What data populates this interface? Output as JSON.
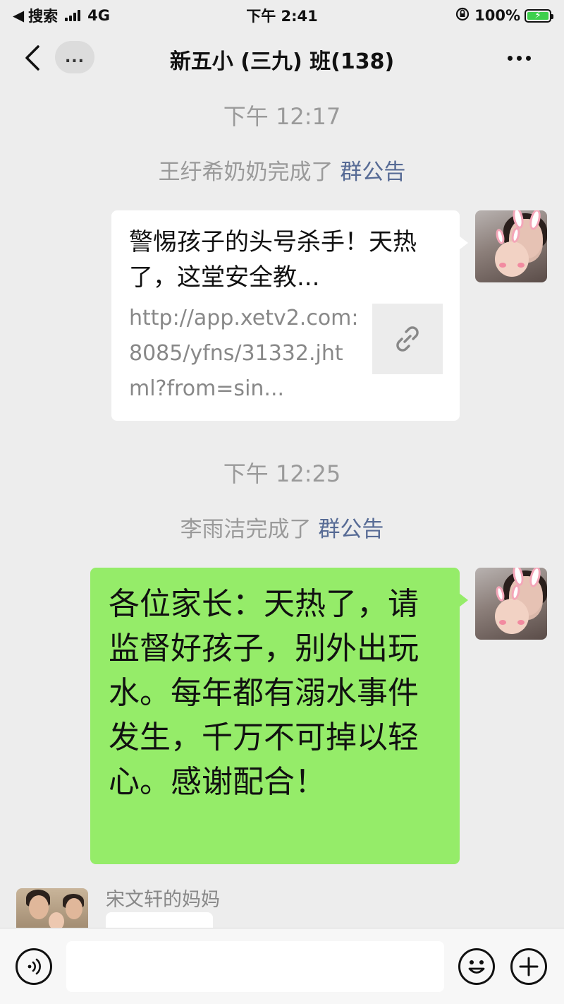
{
  "status_bar": {
    "back_app": "搜索",
    "network": "4G",
    "time": "下午 2:41",
    "battery": "100%"
  },
  "nav": {
    "back_label": "<",
    "unread_label": "...",
    "title": "新五小 (三九) 班(138)",
    "more_icon": "more-dots-icon"
  },
  "messages": [
    {
      "type": "time",
      "text": "下午 12:17"
    },
    {
      "type": "system",
      "text": "王纡希奶奶完成了",
      "link": "群公告"
    },
    {
      "type": "link_card",
      "side": "right",
      "title": "警惕孩子的头号杀手！天热了，这堂安全教...",
      "url": "http://app.xetv2.com:8085/yfns/31332.jhtml?from=sin...",
      "thumb_icon": "link-icon"
    },
    {
      "type": "time",
      "text": "下午 12:25"
    },
    {
      "type": "system",
      "text": "李雨洁完成了",
      "link": "群公告"
    },
    {
      "type": "text",
      "side": "right",
      "text": "各位家长：天热了，请监督好孩子，别外出玩水。每年都有溺水事件发生，千万不可掉以轻心。感谢配合！"
    },
    {
      "type": "text",
      "side": "left",
      "sender": "宋文轩的妈妈",
      "text": ""
    }
  ],
  "input_bar": {
    "voice_icon": "voice-icon",
    "input_value": "",
    "emoji_icon": "emoji-icon",
    "plus_icon": "plus-icon"
  },
  "colors": {
    "background": "#ededed",
    "green_bubble": "#95ec69",
    "link_blue": "#576b95",
    "system_gray": "#9a9a9a"
  }
}
